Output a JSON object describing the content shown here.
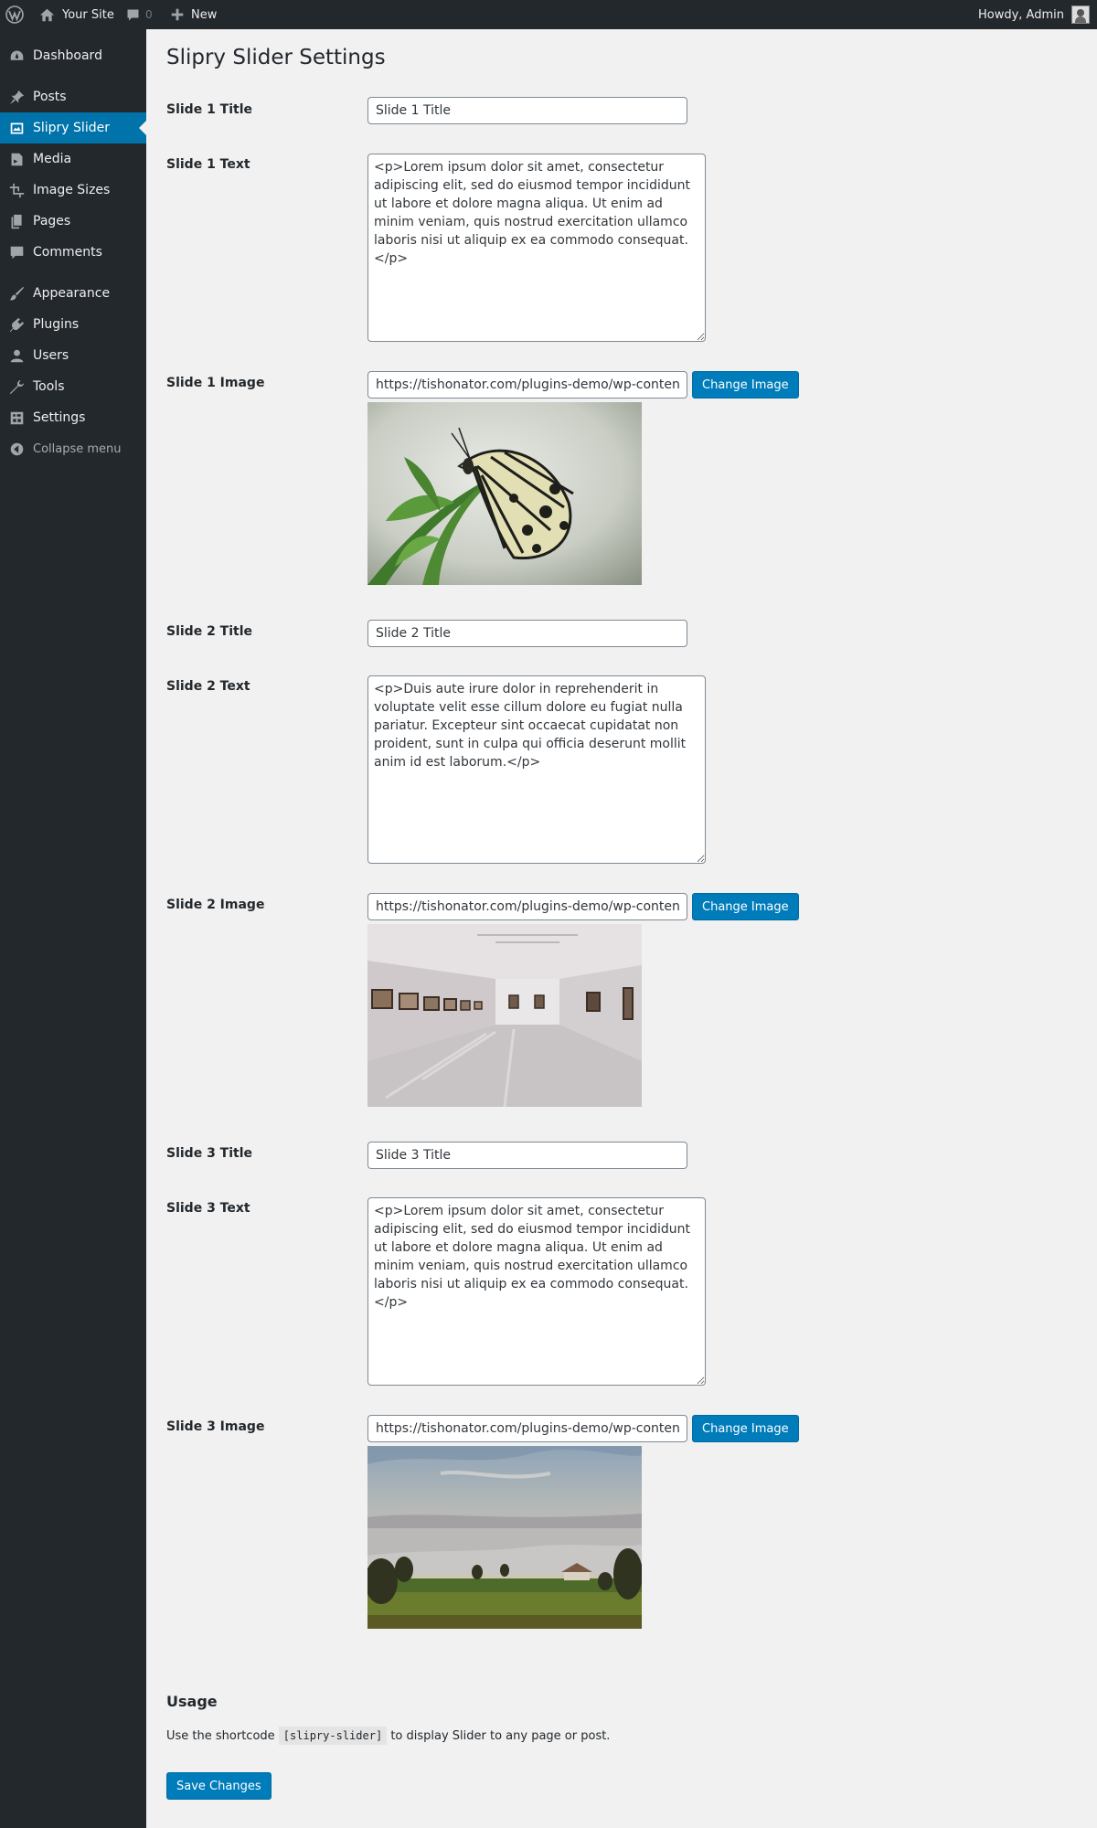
{
  "adminbar": {
    "site_name": "Your Site",
    "comment_count": "0",
    "new_label": "New",
    "howdy": "Howdy, Admin"
  },
  "sidebar": {
    "items": [
      {
        "label": "Dashboard",
        "icon": "dashboard-icon"
      },
      {
        "label": "Posts",
        "icon": "pin-icon"
      },
      {
        "label": "Slipry Slider",
        "icon": "slides-icon",
        "current": true
      },
      {
        "label": "Media",
        "icon": "media-icon"
      },
      {
        "label": "Image Sizes",
        "icon": "crop-icon"
      },
      {
        "label": "Pages",
        "icon": "pages-icon"
      },
      {
        "label": "Comments",
        "icon": "comment-icon"
      },
      {
        "label": "Appearance",
        "icon": "brush-icon"
      },
      {
        "label": "Plugins",
        "icon": "plugin-icon"
      },
      {
        "label": "Users",
        "icon": "user-icon"
      },
      {
        "label": "Tools",
        "icon": "wrench-icon"
      },
      {
        "label": "Settings",
        "icon": "settings-icon"
      },
      {
        "label": "Collapse menu",
        "icon": "collapse-icon"
      }
    ]
  },
  "page": {
    "title": "Slipry Slider Settings"
  },
  "slides": [
    {
      "title_label": "Slide 1 Title",
      "title_value": "Slide 1 Title",
      "text_label": "Slide 1 Text",
      "text_value": "<p>Lorem ipsum dolor sit amet, consectetur adipiscing elit, sed do eiusmod tempor incididunt ut labore et dolore magna aliqua. Ut enim ad minim veniam, quis nostrud exercitation ullamco laboris nisi ut aliquip ex ea commodo consequat.</p>",
      "image_label": "Slide 1 Image",
      "image_url": "https://tishonator.com/plugins-demo/wp-content/uploads",
      "button_label": "Change Image",
      "image_subject": "butterfly"
    },
    {
      "title_label": "Slide 2 Title",
      "title_value": "Slide 2 Title",
      "text_label": "Slide 2 Text",
      "text_value": "<p>Duis aute irure dolor in reprehenderit in voluptate velit esse cillum dolore eu fugiat nulla pariatur. Excepteur sint occaecat cupidatat non proident, sunt in culpa qui officia deserunt mollit anim id est laborum.</p>",
      "image_label": "Slide 2 Image",
      "image_url": "https://tishonator.com/plugins-demo/wp-content/uploads",
      "button_label": "Change Image",
      "image_subject": "gallery"
    },
    {
      "title_label": "Slide 3 Title",
      "title_value": "Slide 3 Title",
      "text_label": "Slide 3 Text",
      "text_value": "<p>Lorem ipsum dolor sit amet, consectetur adipiscing elit, sed do eiusmod tempor incididunt ut labore et dolore magna aliqua. Ut enim ad minim veniam, quis nostrud exercitation ullamco laboris nisi ut aliquip ex ea commodo consequat.</p>",
      "image_label": "Slide 3 Image",
      "image_url": "https://tishonator.com/plugins-demo/wp-content/uploads",
      "button_label": "Change Image",
      "image_subject": "landscape"
    }
  ],
  "usage": {
    "heading": "Usage",
    "text_before": "Use the shortcode",
    "shortcode": "[slipry-slider]",
    "text_after": "to display Slider to any page or post."
  },
  "save_label": "Save Changes",
  "colors": {
    "accent": "#0073aa",
    "button": "#007cba",
    "sidebar": "#23282d",
    "background": "#f1f1f1"
  }
}
